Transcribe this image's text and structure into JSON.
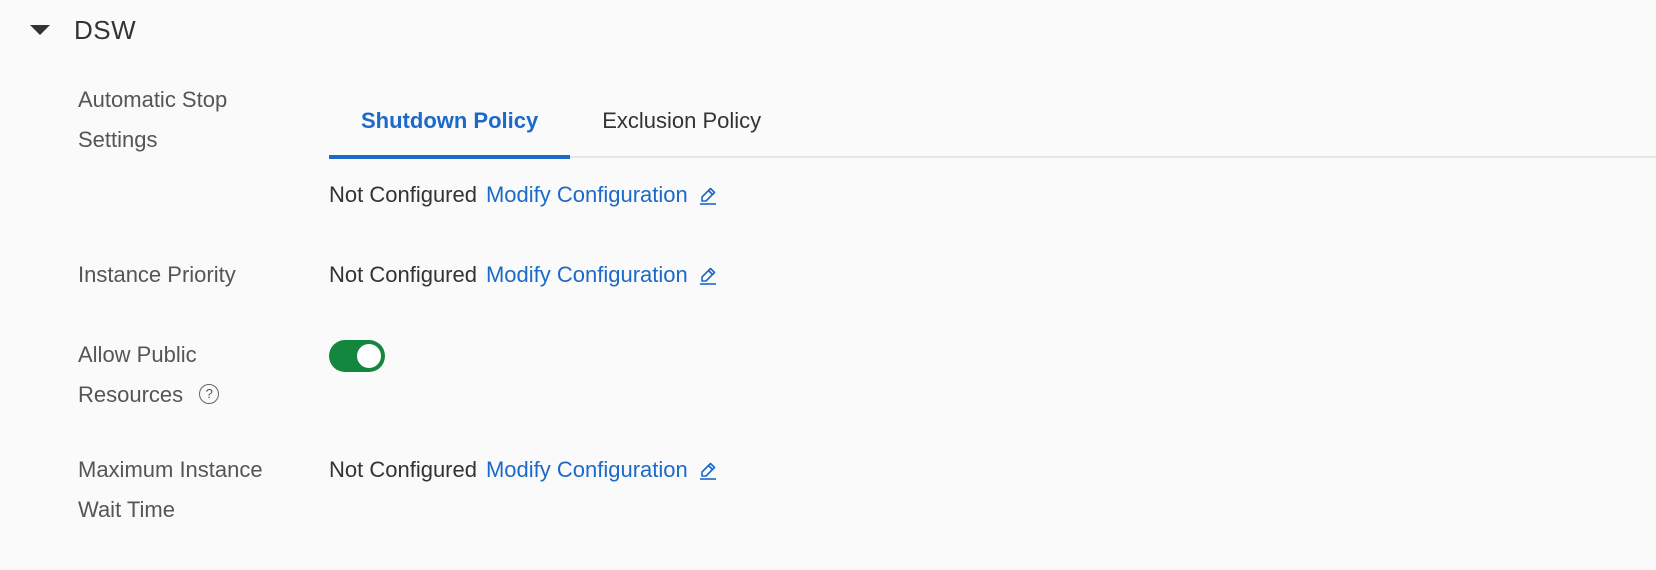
{
  "section": {
    "title": "DSW",
    "expanded": true
  },
  "automatic_stop": {
    "label_line1": "Automatic Stop",
    "label_line2": "Settings",
    "tabs": [
      {
        "label": "Shutdown Policy",
        "active": true
      },
      {
        "label": "Exclusion Policy",
        "active": false
      }
    ],
    "status": "Not Configured",
    "action": "Modify Configuration"
  },
  "instance_priority": {
    "label": "Instance Priority",
    "status": "Not Configured",
    "action": "Modify Configuration"
  },
  "allow_public_resources": {
    "label_line1": "Allow Public",
    "label_line2": "Resources",
    "help": "?",
    "enabled": true
  },
  "max_wait_time": {
    "label_line1": "Maximum Instance",
    "label_line2": "Wait Time",
    "status": "Not Configured",
    "action": "Modify Configuration"
  },
  "colors": {
    "link": "#1b6ac9",
    "toggle_on": "#14873f",
    "background": "#fafafa"
  },
  "icons": {
    "caret": "caret-down-icon",
    "edit": "edit-icon",
    "help": "question-circle-icon"
  }
}
